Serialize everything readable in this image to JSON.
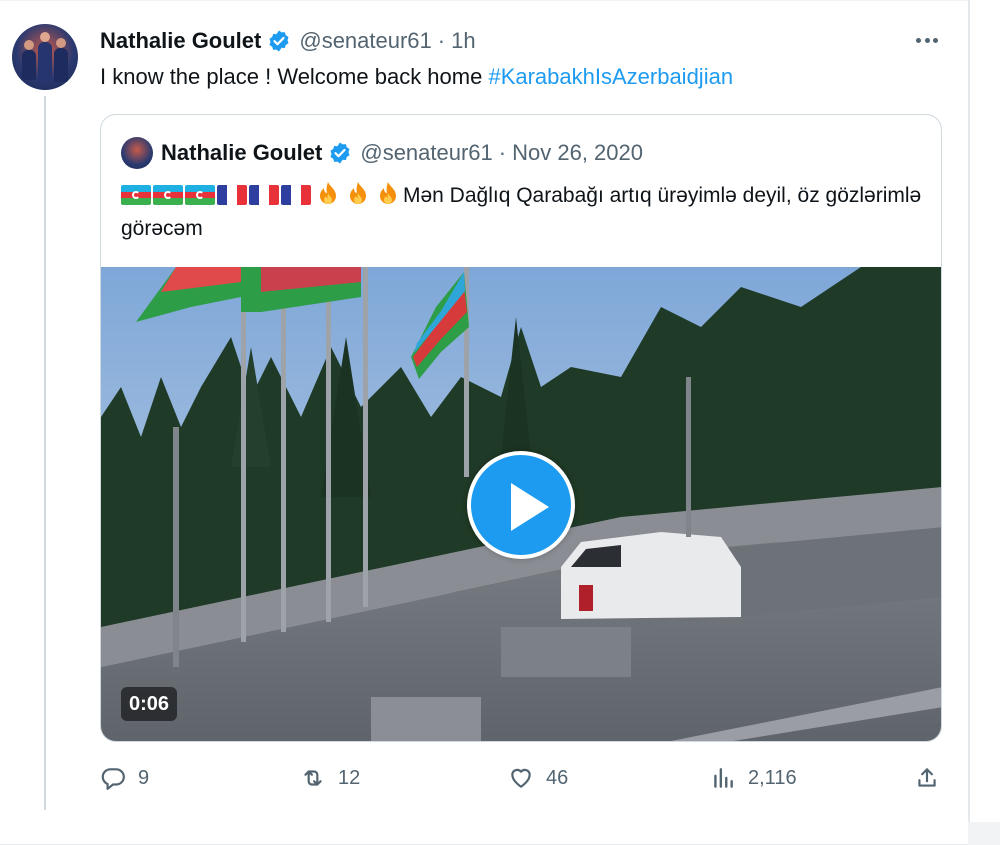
{
  "tweet": {
    "author_name": "Nathalie Goulet",
    "handle": "@senateur61",
    "separator": "·",
    "time": "1h",
    "text": "I know the place ! Welcome back home ",
    "hashtag": "#KarabakhIsAzerbaidjian"
  },
  "quoted": {
    "author_name": "Nathalie Goulet",
    "handle": "@senateur61",
    "separator": "·",
    "date": "Nov 26, 2020",
    "text": "Mən Dağlıq Qarabağı artıq ürəyimlə deyil, öz gözlərimlə görəcəm",
    "emoji": [
      "flag-azerbaijan",
      "flag-azerbaijan",
      "flag-azerbaijan",
      "flag-france",
      "flag-france",
      "flag-france",
      "fire",
      "fire",
      "fire"
    ],
    "video_duration": "0:06"
  },
  "actions": {
    "replies": "9",
    "retweets": "12",
    "likes": "46",
    "views": "2,116"
  },
  "colors": {
    "accent": "#1d9bf0",
    "secondary_text": "#536471",
    "text": "#0f1419",
    "border": "#cfd9de"
  },
  "icons": {
    "verified": "verified-badge-icon",
    "more": "more-dots-icon",
    "reply": "reply-icon",
    "retweet": "retweet-icon",
    "like": "heart-icon",
    "views": "views-chart-icon",
    "share": "share-icon",
    "play": "play-icon"
  }
}
